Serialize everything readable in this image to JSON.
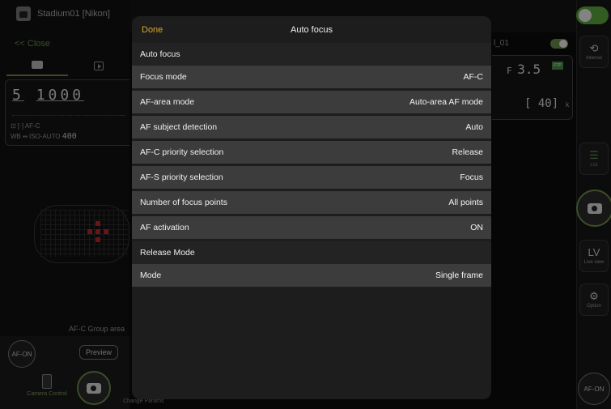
{
  "camera": {
    "name": "Stadium01 [Nikon]",
    "close_label": "<< Close",
    "shutter_speed": "1000",
    "shutter_prefix": "5",
    "af_mode_short": "AF-C",
    "wb_iso": "WB ▪▪  ISO-AUTO",
    "iso_value": "400",
    "group_area_label": "AF-C  Group area",
    "afon_label": "AF-ON",
    "preview_label": "Preview",
    "camera_control_label": "Camera Control",
    "change_params_label": "Change Params"
  },
  "remote": {
    "name": "l_01",
    "aperture_prefix": "F",
    "aperture": "3.5",
    "ftp_badge": "FTP",
    "count": "40",
    "count_unit": "k"
  },
  "rail": {
    "interval_label": "Interval",
    "list_label": "List",
    "lv_glyph": "LV",
    "lv_label": "Live view",
    "option_label": "Option",
    "afon_label": "AF-ON"
  },
  "modal": {
    "done_label": "Done",
    "title": "Auto focus",
    "sections": [
      {
        "title": "Auto focus",
        "rows": [
          {
            "label": "Focus mode",
            "value": "AF-C"
          },
          {
            "label": "AF-area mode",
            "value": "Auto-area AF mode"
          },
          {
            "label": "AF subject detection",
            "value": "Auto"
          },
          {
            "label": "AF-C priority selection",
            "value": "Release"
          },
          {
            "label": "AF-S priority selection",
            "value": "Focus"
          },
          {
            "label": "Number of focus points",
            "value": "All points"
          },
          {
            "label": "AF activation",
            "value": "ON"
          }
        ]
      },
      {
        "title": "Release Mode",
        "rows": [
          {
            "label": "Mode",
            "value": "Single frame"
          }
        ]
      }
    ]
  },
  "colors": {
    "accent_green": "#6b8d49",
    "done_yellow": "#d6a92d",
    "row_bg": "#3c3c3c",
    "modal_bg": "#1d1d1d"
  }
}
